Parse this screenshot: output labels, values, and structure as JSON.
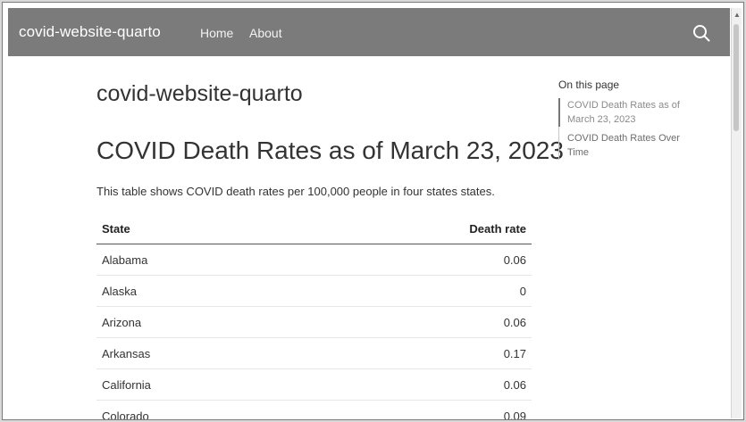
{
  "navbar": {
    "brand": "covid-website-quarto",
    "links": [
      {
        "label": "Home"
      },
      {
        "label": "About"
      }
    ],
    "search_icon": "search-icon"
  },
  "main": {
    "page_title": "covid-website-quarto",
    "section_title": "COVID Death Rates as of March 23, 2023",
    "intro": "This table shows COVID death rates per 100,000 people in four states states.",
    "table": {
      "headers": [
        "State",
        "Death rate"
      ],
      "rows": [
        [
          "Alabama",
          "0.06"
        ],
        [
          "Alaska",
          "0"
        ],
        [
          "Arizona",
          "0.06"
        ],
        [
          "Arkansas",
          "0.17"
        ],
        [
          "California",
          "0.06"
        ],
        [
          "Colorado",
          "0.09"
        ]
      ]
    }
  },
  "toc": {
    "heading": "On this page",
    "items": [
      {
        "label": "COVID Death Rates as of March 23, 2023"
      },
      {
        "label": "COVID Death Rates Over Time"
      }
    ]
  }
}
